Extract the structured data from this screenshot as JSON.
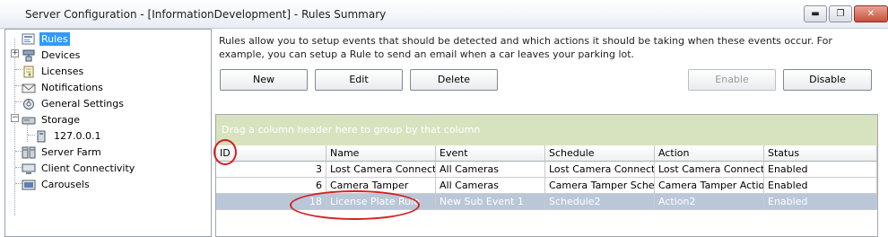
{
  "window": {
    "title": "Server Configuration - [InformationDevelopment] - Rules Summary",
    "minimize_label": "▬",
    "restore_label": "❐",
    "close_label": "✕"
  },
  "tree": {
    "items": [
      {
        "label": "Rules",
        "icon": "rules-icon"
      },
      {
        "label": "Devices",
        "icon": "devices-icon"
      },
      {
        "label": "Licenses",
        "icon": "licenses-icon"
      },
      {
        "label": "Notifications",
        "icon": "notifications-icon"
      },
      {
        "label": "General Settings",
        "icon": "settings-icon"
      },
      {
        "label": "Storage",
        "icon": "storage-icon"
      },
      {
        "label": "127.0.0.1",
        "icon": "disk-icon"
      },
      {
        "label": "Server Farm",
        "icon": "server-farm-icon"
      },
      {
        "label": "Client Connectivity",
        "icon": "client-connectivity-icon"
      },
      {
        "label": "Carousels",
        "icon": "carousels-icon"
      }
    ],
    "expand_symbol": "+",
    "collapse_symbol": "−"
  },
  "main": {
    "description": "Rules allow you to setup events that should be detected and which actions it should be taking when these events occur.   For example, you can setup a Rule to send an email when a car leaves your parking lot.",
    "buttons": {
      "new": "New",
      "edit": "Edit",
      "delete": "Delete",
      "enable": "Enable",
      "disable": "Disable"
    },
    "grid": {
      "group_hint": "Drag a column header here to group by that column",
      "columns": [
        "ID",
        "Name",
        "Event",
        "Schedule",
        "Action",
        "Status"
      ],
      "rows": [
        [
          "3",
          "Lost Camera Connecti...",
          "All Cameras",
          "Lost Camera Connecti...",
          "Lost Camera Connecti...",
          "Enabled"
        ],
        [
          "6",
          "Camera Tamper",
          "All Cameras",
          "Camera Tamper Sche...",
          "Camera Tamper Action",
          "Enabled"
        ],
        [
          "18",
          "License Plate Rule",
          "New Sub Event 1",
          "Schedule2",
          "Action2",
          "Enabled"
        ]
      ],
      "selected_row": 2
    }
  },
  "colors": {
    "selection": "#3399ff",
    "group_area": "#d7e3bf",
    "annotation": "#d42222"
  }
}
